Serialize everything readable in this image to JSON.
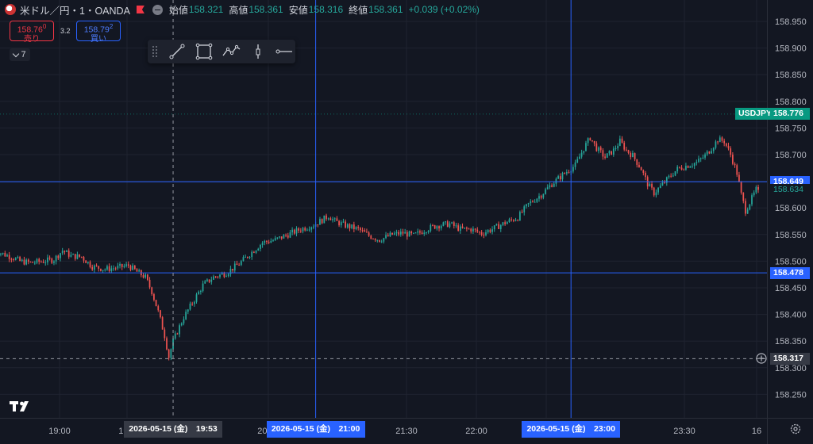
{
  "legend": {
    "symbol": "米ドル／円・1・OANDA",
    "open_label": "始値",
    "open": "158.321",
    "high_label": "高値",
    "high": "158.361",
    "low_label": "安値",
    "low": "158.316",
    "close_label": "終値",
    "close": "158.361",
    "change": "+0.039 (+0.02%)"
  },
  "trade": {
    "sell_price_main": "158.76",
    "sell_price_sup": "0",
    "sell_label": "売り",
    "buy_price_main": "158.79",
    "buy_price_sup": "2",
    "buy_label": "買い",
    "spread": "3.2"
  },
  "interval": "7",
  "toolbar": {
    "tools": [
      "trend-line-icon",
      "rectangle-icon",
      "path-icon",
      "long-position-icon",
      "horizontal-ray-icon"
    ]
  },
  "price_tags": {
    "symbol_label": "USDJPY",
    "symbol_price": "158.776",
    "hline1": "158.649",
    "last": "158.634",
    "hline2": "158.478",
    "cursor": "158.317"
  },
  "time_tags": {
    "cursor": "2026-05-15 (金)　19:53",
    "vline1": "2026-05-15 (金)　21:00",
    "vline2": "2026-05-15 (金)　23:00"
  },
  "colors": {
    "background": "#131722",
    "grid": "#1f2330",
    "up": "#26a69a",
    "down": "#ef5350",
    "line": "#2962ff",
    "tag_blue": "#2962ff",
    "symbol_tag": "#089981"
  },
  "chart_data": {
    "type": "candlestick",
    "x_ticks": [
      "19:00",
      "19:3",
      "20:30",
      "21:30",
      "22:00",
      "22:30",
      "23:30",
      "16"
    ],
    "y_ticks": [
      "158.950",
      "158.900",
      "158.850",
      "158.800",
      "158.750",
      "158.700",
      "158.650",
      "158.600",
      "158.550",
      "158.500",
      "158.450",
      "158.400",
      "158.350",
      "158.300",
      "158.250"
    ],
    "y_range": [
      158.22,
      158.99
    ],
    "x_range_minutes": [
      1109,
      1468
    ],
    "keypoints": [
      [
        1109,
        158.53
      ],
      [
        1113,
        158.515
      ],
      [
        1118,
        158.508
      ],
      [
        1122,
        158.5
      ],
      [
        1127,
        158.497
      ],
      [
        1133,
        158.5
      ],
      [
        1138,
        158.503
      ],
      [
        1142,
        158.52
      ],
      [
        1146,
        158.51
      ],
      [
        1151,
        158.508
      ],
      [
        1156,
        158.49
      ],
      [
        1162,
        158.485
      ],
      [
        1168,
        158.488
      ],
      [
        1173,
        158.492
      ],
      [
        1177,
        158.48
      ],
      [
        1181,
        158.47
      ],
      [
        1184,
        158.443
      ],
      [
        1187,
        158.405
      ],
      [
        1190,
        158.36
      ],
      [
        1192,
        158.32
      ],
      [
        1194,
        158.35
      ],
      [
        1199,
        158.395
      ],
      [
        1204,
        158.428
      ],
      [
        1208,
        158.455
      ],
      [
        1213,
        158.47
      ],
      [
        1219,
        158.478
      ],
      [
        1225,
        158.495
      ],
      [
        1231,
        158.517
      ],
      [
        1236,
        158.535
      ],
      [
        1242,
        158.54
      ],
      [
        1248,
        158.55
      ],
      [
        1254,
        158.56
      ],
      [
        1260,
        158.568
      ],
      [
        1264,
        158.577
      ],
      [
        1267,
        158.585
      ],
      [
        1270,
        158.575
      ],
      [
        1275,
        158.567
      ],
      [
        1281,
        158.56
      ],
      [
        1286,
        158.548
      ],
      [
        1291,
        158.54
      ],
      [
        1297,
        158.55
      ],
      [
        1302,
        158.553
      ],
      [
        1307,
        158.548
      ],
      [
        1313,
        158.56
      ],
      [
        1318,
        158.567
      ],
      [
        1324,
        158.57
      ],
      [
        1329,
        158.56
      ],
      [
        1334,
        158.56
      ],
      [
        1339,
        158.552
      ],
      [
        1345,
        158.562
      ],
      [
        1350,
        158.572
      ],
      [
        1356,
        158.582
      ],
      [
        1361,
        158.607
      ],
      [
        1367,
        158.625
      ],
      [
        1372,
        158.645
      ],
      [
        1378,
        158.665
      ],
      [
        1383,
        158.68
      ],
      [
        1387,
        158.712
      ],
      [
        1390,
        158.732
      ],
      [
        1393,
        158.712
      ],
      [
        1397,
        158.695
      ],
      [
        1401,
        158.708
      ],
      [
        1404,
        158.725
      ],
      [
        1407,
        158.708
      ],
      [
        1410,
        158.698
      ],
      [
        1414,
        158.673
      ],
      [
        1417,
        158.645
      ],
      [
        1420,
        158.628
      ],
      [
        1423,
        158.64
      ],
      [
        1427,
        158.657
      ],
      [
        1431,
        158.673
      ],
      [
        1436,
        158.68
      ],
      [
        1440,
        158.685
      ],
      [
        1444,
        158.698
      ],
      [
        1447,
        158.712
      ],
      [
        1450,
        158.728
      ],
      [
        1453,
        158.725
      ],
      [
        1456,
        158.7
      ],
      [
        1459,
        158.665
      ],
      [
        1461,
        158.625
      ],
      [
        1463,
        158.595
      ],
      [
        1465,
        158.61
      ],
      [
        1468,
        158.634
      ]
    ],
    "hlines": [
      158.649,
      158.478
    ],
    "symbol_line": 158.776,
    "cursor_price": 158.317,
    "cursor_time": 1193,
    "vlines": [
      1260,
      1380
    ]
  }
}
